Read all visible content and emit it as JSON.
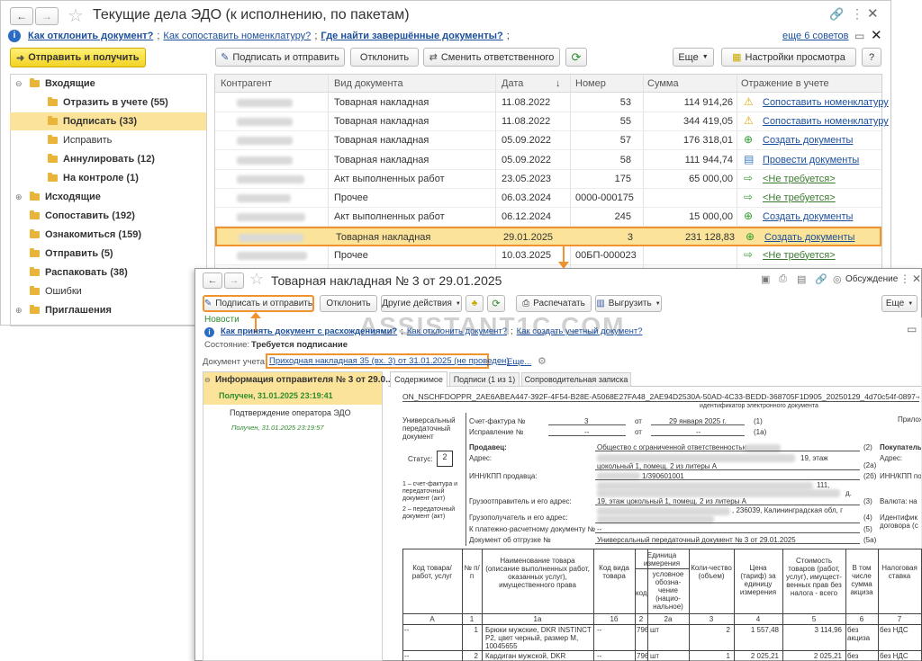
{
  "main": {
    "title": "Текущие дела ЭДО (к исполнению, по пакетам)",
    "hints": [
      "Как отклонить документ?",
      "Как сопоставить номенклатуру?",
      "Где найти завершённые документы?"
    ],
    "hint_separators": ";",
    "tips_link": "еще 6 советов",
    "send_receive": "Отправить и получить",
    "toolbar": {
      "sign_send": "Подписать и отправить",
      "reject": "Отклонить",
      "change_resp": "Сменить ответственного",
      "more": "Еще",
      "view_settings": "Настройки просмотра",
      "help": "?"
    },
    "tree": [
      {
        "label": "Входящие",
        "level": 0,
        "bold": true,
        "toggle": "⊖"
      },
      {
        "label": "Отразить в учете (55)",
        "level": 1,
        "bold": true
      },
      {
        "label": "Подписать (33)",
        "level": 1,
        "bold": true,
        "selected": true
      },
      {
        "label": "Исправить",
        "level": 1,
        "bold": false
      },
      {
        "label": "Аннулировать (12)",
        "level": 1,
        "bold": true
      },
      {
        "label": "На контроле (1)",
        "level": 1,
        "bold": true
      },
      {
        "label": "Исходящие",
        "level": 0,
        "bold": true,
        "toggle": "⊕"
      },
      {
        "label": "Сопоставить (192)",
        "level": 0,
        "bold": true
      },
      {
        "label": "Ознакомиться (159)",
        "level": 0,
        "bold": true
      },
      {
        "label": "Отправить (5)",
        "level": 0,
        "bold": true
      },
      {
        "label": "Распаковать (38)",
        "level": 0,
        "bold": true
      },
      {
        "label": "Ошибки",
        "level": 0,
        "bold": false
      },
      {
        "label": "Приглашения",
        "level": 0,
        "bold": true,
        "toggle": "⊕"
      }
    ],
    "columns": [
      "Контрагент",
      "Вид документа",
      "Дата",
      "Номер",
      "Сумма",
      "Отражение в учете"
    ],
    "rows": [
      {
        "doc": "Товарная накладная",
        "date": "11.08.2022",
        "num": "53",
        "sum": "114 914,26",
        "action": "Сопоставить номенклатуру",
        "icon": "warning"
      },
      {
        "doc": "Товарная накладная",
        "date": "11.08.2022",
        "num": "55",
        "sum": "344 419,05",
        "action": "Сопоставить номенклатуру",
        "icon": "warning"
      },
      {
        "doc": "Товарная накладная",
        "date": "05.09.2022",
        "num": "57",
        "sum": "176 318,01",
        "action": "Создать документы",
        "icon": "plus"
      },
      {
        "doc": "Товарная накладная",
        "date": "05.09.2022",
        "num": "58",
        "sum": "111 944,74",
        "action": "Провести документы",
        "icon": "post"
      },
      {
        "doc": "Акт выполненных работ",
        "date": "23.05.2023",
        "num": "175",
        "sum": "65 000,00",
        "action": "<Не требуется>",
        "icon": "skip"
      },
      {
        "doc": "Прочее",
        "date": "06.03.2024",
        "num": "0000-000175",
        "sum": "",
        "action": "<Не требуется>",
        "icon": "skip"
      },
      {
        "doc": "Акт выполненных работ",
        "date": "06.12.2024",
        "num": "245",
        "sum": "15 000,00",
        "action": "Создать документы",
        "icon": "plus"
      },
      {
        "doc": "Товарная накладная",
        "date": "29.01.2025",
        "num": "3",
        "sum": "231 128,83",
        "action": "Создать документы",
        "icon": "plus",
        "selected": true
      },
      {
        "doc": "Прочее",
        "date": "10.03.2025",
        "num": "00БП-000023",
        "sum": "",
        "action": "<Не требуется>",
        "icon": "skip"
      }
    ]
  },
  "doc": {
    "title": "Товарная накладная № 3 от 29.01.2025",
    "discussion": "Обсуждение",
    "toolbar": {
      "sign_send": "Подписать и отправить",
      "reject": "Отклонить",
      "other": "Другие действия",
      "print": "Распечатать",
      "export": "Выгрузить",
      "more": "Еще"
    },
    "news": "Новости",
    "hints": [
      "Как принять документ с расхождениями?",
      "Как отклонить документ?",
      "Как создать учетный документ?"
    ],
    "state_label": "Состояние:",
    "state_value": "Требуется подписание",
    "acc_doc_label": "Документ учета:",
    "acc_doc_link": "Приходная накладная 35 (вх. 3) от 31.01.2025 (не проведен)",
    "acc_more": "Еще...",
    "watermark": "ASSISTANT1C.COM",
    "left_panel": {
      "header": "Информация отправителя № 3 от 29.0...",
      "received": "Получен, 31.01.2025 23:19:41",
      "confirm": "Подтверждение оператора ЭДО",
      "confirm_time": "Получен, 31.01.2025 23:19:57"
    },
    "tabs": [
      "Содержимое",
      "Подписи (1 из 1)",
      "Сопроводительная записка"
    ],
    "file_id": "ON_NSCHFDOPPR_2AE6ABEA447-392F-4F54-B28E-A5068E27FA48_2AE94D2530A-50AD-4C33-BEDD-368705F1D905_20250129_4d70c54f-0897-4c03-8c30-89d97(",
    "file_id_caption": "идентификатор электронного документа",
    "upd": {
      "left_caption": "Универсальный передаточный документ",
      "status_label": "Статус:",
      "status_value": "2",
      "status_note1": "1 – счет-фактура и передаточный документ (акт)",
      "status_note2": "2 – передаточный документ (акт)",
      "invoice_label": "Счет-фактура №",
      "invoice_num": "3",
      "from_word": "от",
      "invoice_date": "29 января 2025 г.",
      "invoice_code": "(1)",
      "correction_label": "Исправление №",
      "correction_num": "--",
      "correction_from": "от",
      "correction_date": "--",
      "correction_code": "(1а)",
      "appendix": "Прилож",
      "seller_label": "Продавец:",
      "seller_value": "Общество с ограниченной ответственностью",
      "seller_code": "(2)",
      "address_label": "Адрес:",
      "address_value": "19, этаж",
      "address_value2": "цокольный 1, помещ. 2 из литеры А",
      "address_code": "(2а)",
      "inn_label": "ИНН/КПП продавца:",
      "inn_value": "1/390601001",
      "inn_code": "(2б)",
      "shipper_label": "Грузоотправитель и его адрес:",
      "shipper_value": "19, этаж цокольный 1, помещ. 2 из литеры А",
      "shipper_extra": "111,",
      "shipper_extra2": "д.",
      "shipper_code": "(3)",
      "consignee_label": "Грузополучатель и его адрес:",
      "consignee_value": ", 236039, Калининградская обл, г",
      "consignee_code": "(4)",
      "payment_label": "К платежно-расчетному документу №",
      "payment_value": "--",
      "payment_code": "(5)",
      "shipment_label": "Документ об отгрузке №",
      "shipment_value": "Универсальный передаточный документ № 3 от 29.01.2025",
      "shipment_code": "(5а)",
      "buyer_label": "Покупатель",
      "buyer_address": "Адрес:",
      "buyer_inn": "ИНН/КПП по",
      "currency": "Валюта: на",
      "identifier": "Идентифик договора (с"
    },
    "table": {
      "headers": [
        "Код товара/ работ, услуг",
        "№ п/п",
        "Наименование товара (описание выполненных работ, оказанных услуг), имущественного права",
        "Код вида товара",
        "Единица измерения",
        "Коли-чество (объем)",
        "Цена (тариф) за единицу измерения",
        "Стоимость товаров (работ, услуг), имущест-венных прав без налога - всего",
        "В том числе сумма акциза",
        "Налоговая ставка"
      ],
      "unit_sub": [
        "код",
        "условное обозна-чение (нацио-нальное)"
      ],
      "numbers": [
        "А",
        "1",
        "1а",
        "1б",
        "2",
        "2а",
        "3",
        "4",
        "5",
        "6",
        "7"
      ],
      "rows": [
        {
          "code": "--",
          "n": "1",
          "name": "Брюки мужские, DKR INSTINCT P2, цвет черный, размер M, 10045655",
          "kind": "--",
          "ucode": "796",
          "uname": "шт",
          "qty": "2",
          "price": "1 557,48",
          "cost": "3 114,96",
          "excise": "без акциза",
          "rate": "без НДС"
        },
        {
          "code": "--",
          "n": "2",
          "name": "Кардиган мужской, DKR",
          "kind": "--",
          "ucode": "796",
          "uname": "шт",
          "qty": "1",
          "price": "2 025,21",
          "cost": "2 025,21",
          "excise": "без",
          "rate": "без НДС"
        }
      ]
    }
  },
  "colors": {
    "accent_yellow": "#fbe49a",
    "highlight_orange": "#f0922e",
    "link": "#1c4f9c",
    "green": "#2e8b2e"
  }
}
